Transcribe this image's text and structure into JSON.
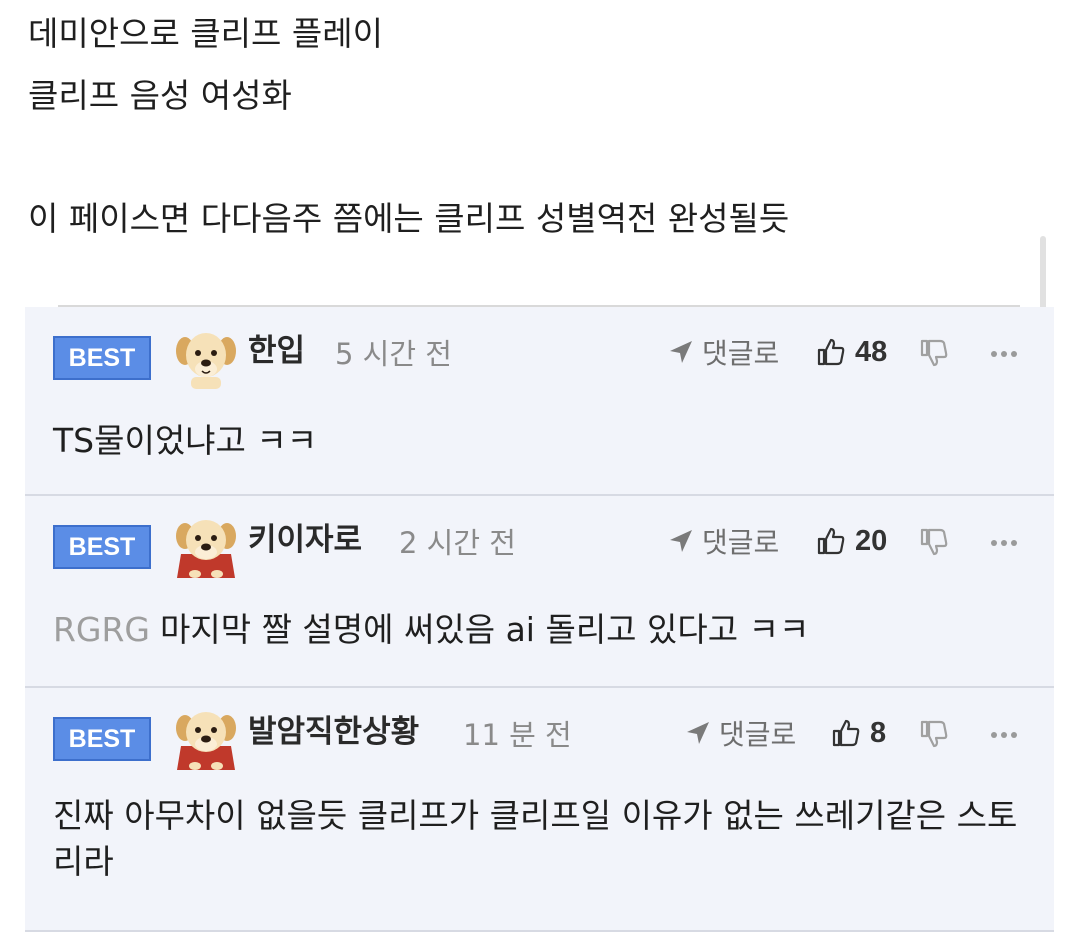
{
  "post": {
    "lines": [
      "데미안으로 클리프 플레이",
      "클리프 음성 여성화",
      "이 페이스면 다다음주 쯤에는 클리프 성별역전 완성될듯"
    ]
  },
  "comments": [
    {
      "badge": "BEST",
      "nickname": "한입",
      "time": "5 시간 전",
      "reply_label": "댓글로",
      "likes": "48",
      "reply_target": "",
      "text": "TS물이었냐고 ㅋㅋ",
      "avatar": "puppy-avatar"
    },
    {
      "badge": "BEST",
      "nickname": "키이자로",
      "time": "2 시간 전",
      "reply_label": "댓글로",
      "likes": "20",
      "reply_target": "RGRG",
      "text": "마지막 짤 설명에 써있음 ai 돌리고 있다고 ㅋㅋ",
      "avatar": "puppy-cape-avatar"
    },
    {
      "badge": "BEST",
      "nickname": "발암직한상황",
      "time": "11 분 전",
      "reply_label": "댓글로",
      "likes": "8",
      "reply_target": "",
      "text": "진짜 아무차이 없을듯 클리프가 클리프일 이유가 없는 쓰레기같은 스토리라",
      "avatar": "puppy-cape-avatar"
    }
  ],
  "colors": {
    "badge": "#5b8de6",
    "comment_bg": "#f2f4fa",
    "muted_text": "#8a8a8a"
  }
}
